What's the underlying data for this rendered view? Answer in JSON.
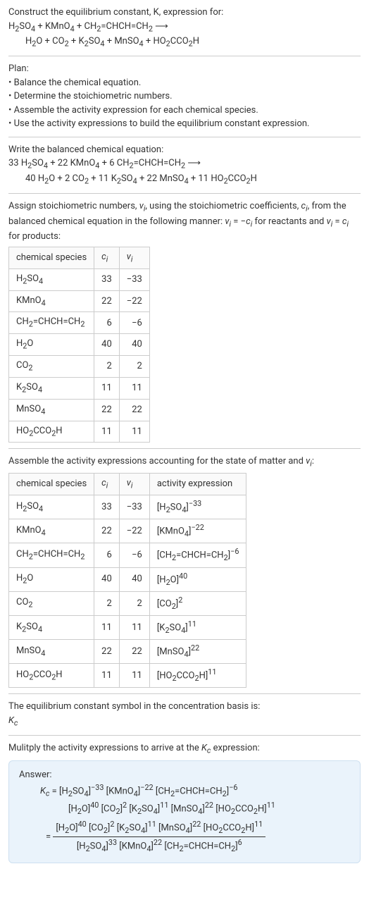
{
  "intro": {
    "title": "Construct the equilibrium constant, K, expression for:",
    "eq_left_html": "H<sub>2</sub>SO<sub>4</sub> + KMnO<sub>4</sub> + CH<sub>2</sub>=CHCH=CH<sub>2</sub> ⟶",
    "eq_right_html": "H<sub>2</sub>O + CO<sub>2</sub> + K<sub>2</sub>SO<sub>4</sub> + MnSO<sub>4</sub> + HO<sub>2</sub>CCO<sub>2</sub>H"
  },
  "plan": {
    "heading": "Plan:",
    "items": [
      "Balance the chemical equation.",
      "Determine the stoichiometric numbers.",
      "Assemble the activity expression for each chemical species.",
      "Use the activity expressions to build the equilibrium constant expression."
    ]
  },
  "balanced": {
    "heading": "Write the balanced chemical equation:",
    "left_html": "33 H<sub>2</sub>SO<sub>4</sub> + 22 KMnO<sub>4</sub> + 6 CH<sub>2</sub>=CHCH=CH<sub>2</sub> ⟶",
    "right_html": "40 H<sub>2</sub>O + 2 CO<sub>2</sub> + 11 K<sub>2</sub>SO<sub>4</sub> + 22 MnSO<sub>4</sub> + 11 HO<sub>2</sub>CCO<sub>2</sub>H"
  },
  "assign": {
    "text_html": "Assign stoichiometric numbers, <i>ν<sub>i</sub></i>, using the stoichiometric coefficients, <i>c<sub>i</sub></i>, from the balanced chemical equation in the following manner: <i>ν<sub>i</sub></i> = −<i>c<sub>i</sub></i> for reactants and <i>ν<sub>i</sub></i> = <i>c<sub>i</sub></i> for products:"
  },
  "table1": {
    "headers": [
      "chemical species",
      "cᵢ",
      "νᵢ"
    ],
    "headers_html": [
      "chemical species",
      "<i>c<sub>i</sub></i>",
      "<i>ν<sub>i</sub></i>"
    ],
    "rows": [
      {
        "species_html": "H<sub>2</sub>SO<sub>4</sub>",
        "c": "33",
        "v": "−33"
      },
      {
        "species_html": "KMnO<sub>4</sub>",
        "c": "22",
        "v": "−22"
      },
      {
        "species_html": "CH<sub>2</sub>=CHCH=CH<sub>2</sub>",
        "c": "6",
        "v": "−6"
      },
      {
        "species_html": "H<sub>2</sub>O",
        "c": "40",
        "v": "40"
      },
      {
        "species_html": "CO<sub>2</sub>",
        "c": "2",
        "v": "2"
      },
      {
        "species_html": "K<sub>2</sub>SO<sub>4</sub>",
        "c": "11",
        "v": "11"
      },
      {
        "species_html": "MnSO<sub>4</sub>",
        "c": "22",
        "v": "22"
      },
      {
        "species_html": "HO<sub>2</sub>CCO<sub>2</sub>H",
        "c": "11",
        "v": "11"
      }
    ]
  },
  "activity_heading_html": "Assemble the activity expressions accounting for the state of matter and <i>ν<sub>i</sub></i>:",
  "table2": {
    "headers_html": [
      "chemical species",
      "<i>c<sub>i</sub></i>",
      "<i>ν<sub>i</sub></i>",
      "activity expression"
    ],
    "rows": [
      {
        "species_html": "H<sub>2</sub>SO<sub>4</sub>",
        "c": "33",
        "v": "−33",
        "act_html": "[H<sub>2</sub>SO<sub>4</sub>]<sup>−33</sup>"
      },
      {
        "species_html": "KMnO<sub>4</sub>",
        "c": "22",
        "v": "−22",
        "act_html": "[KMnO<sub>4</sub>]<sup>−22</sup>"
      },
      {
        "species_html": "CH<sub>2</sub>=CHCH=CH<sub>2</sub>",
        "c": "6",
        "v": "−6",
        "act_html": "[CH<sub>2</sub>=CHCH=CH<sub>2</sub>]<sup>−6</sup>"
      },
      {
        "species_html": "H<sub>2</sub>O",
        "c": "40",
        "v": "40",
        "act_html": "[H<sub>2</sub>O]<sup>40</sup>"
      },
      {
        "species_html": "CO<sub>2</sub>",
        "c": "2",
        "v": "2",
        "act_html": "[CO<sub>2</sub>]<sup>2</sup>"
      },
      {
        "species_html": "K<sub>2</sub>SO<sub>4</sub>",
        "c": "11",
        "v": "11",
        "act_html": "[K<sub>2</sub>SO<sub>4</sub>]<sup>11</sup>"
      },
      {
        "species_html": "MnSO<sub>4</sub>",
        "c": "22",
        "v": "22",
        "act_html": "[MnSO<sub>4</sub>]<sup>22</sup>"
      },
      {
        "species_html": "HO<sub>2</sub>CCO<sub>2</sub>H",
        "c": "11",
        "v": "11",
        "act_html": "[HO<sub>2</sub>CCO<sub>2</sub>H]<sup>11</sup>"
      }
    ]
  },
  "eq_symbol": {
    "heading": "The equilibrium constant symbol in the concentration basis is:",
    "value_html": "<i>K<sub>c</sub></i>"
  },
  "multiply_heading_html": "Mulitply the activity expressions to arrive at the <i>K<sub>c</sub></i> expression:",
  "answer": {
    "heading": "Answer:",
    "line1_html": "<i>K<sub>c</sub></i> = [H<sub>2</sub>SO<sub>4</sub>]<sup>−33</sup> [KMnO<sub>4</sub>]<sup>−22</sup> [CH<sub>2</sub>=CHCH=CH<sub>2</sub>]<sup>−6</sup>",
    "line2_html": "[H<sub>2</sub>O]<sup>40</sup> [CO<sub>2</sub>]<sup>2</sup> [K<sub>2</sub>SO<sub>4</sub>]<sup>11</sup> [MnSO<sub>4</sub>]<sup>22</sup> [HO<sub>2</sub>CCO<sub>2</sub>H]<sup>11</sup>",
    "frac_num_html": "[H<sub>2</sub>O]<sup>40</sup> [CO<sub>2</sub>]<sup>2</sup> [K<sub>2</sub>SO<sub>4</sub>]<sup>11</sup> [MnSO<sub>4</sub>]<sup>22</sup> [HO<sub>2</sub>CCO<sub>2</sub>H]<sup>11</sup>",
    "frac_den_html": "[H<sub>2</sub>SO<sub>4</sub>]<sup>33</sup> [KMnO<sub>4</sub>]<sup>22</sup> [CH<sub>2</sub>=CHCH=CH<sub>2</sub>]<sup>6</sup>",
    "eq_prefix": "= "
  }
}
